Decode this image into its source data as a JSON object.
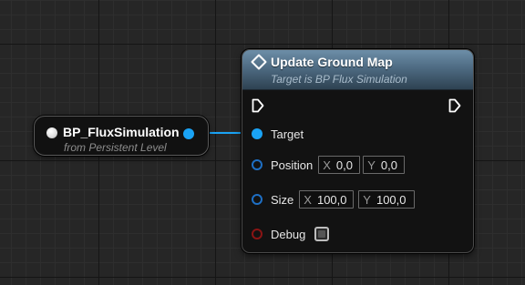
{
  "reference_node": {
    "title": "BP_FluxSimulation",
    "subtitle": "from Persistent Level",
    "output_pin_color": "#1aa3f5"
  },
  "function_node": {
    "title": "Update Ground Map",
    "subtitle": "Target is BP Flux Simulation",
    "icon": "function-icon",
    "header_color": "#4e6b82",
    "pins": {
      "target": {
        "label": "Target",
        "color": "#1aa3f5"
      },
      "position": {
        "label": "Position",
        "x_axis": "X",
        "x_value": "0,0",
        "y_axis": "Y",
        "y_value": "0,0",
        "color": "#1e6fc4"
      },
      "size": {
        "label": "Size",
        "x_axis": "X",
        "x_value": "100,0",
        "y_axis": "Y",
        "y_value": "100,0",
        "color": "#1e6fc4"
      },
      "debug": {
        "label": "Debug",
        "checked": false,
        "color": "#8a1414"
      }
    }
  },
  "connection": {
    "from": "reference_node.output",
    "to": "function_node.target",
    "color": "#1aa3f5"
  }
}
